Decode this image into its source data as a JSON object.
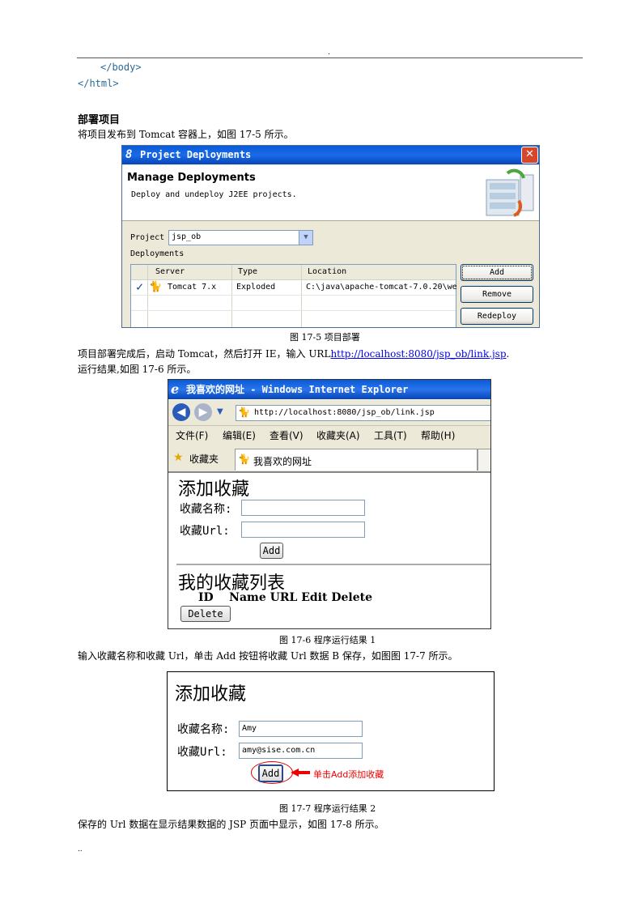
{
  "header_mark": ".",
  "code_lines": [
    "</body>",
    "</html>"
  ],
  "section_heading": "部署项目",
  "para1": "将项目发布到 Tomcat 容器上，如图 17-5 所示。",
  "fig_deploy": {
    "title": "Project Deployments",
    "title_icon": "eclipse-8-icon",
    "close": "✕",
    "heading": "Manage Deployments",
    "subheading": "Deploy and undeploy J2EE projects.",
    "project_label": "Project",
    "project_value": "jsp_ob",
    "deployments_label": "Deployments",
    "columns": [
      "Server",
      "Type",
      "Location"
    ],
    "row": {
      "server": "Tomcat  7.x",
      "type": "Exploded",
      "location": "C:\\java\\apache-tomcat-7.0.20\\we"
    },
    "buttons": {
      "add": "Add",
      "remove": "Remove",
      "redeploy": "Redeploy"
    }
  },
  "caption1": "图 17-5    项目部署",
  "para2_prefix": "项目部署完成后，启动 Tomcat，然后打开 IE，输入 URL",
  "para2_link": "http://localhost:8080/jsp_ob/link.jsp",
  "para2_suffix": ".",
  "para3": "运行结果,如图 17-6 所示。",
  "fig_ie": {
    "title": "我喜欢的网址 - Windows Internet Explorer",
    "url": "http://localhost:8080/jsp_ob/link.jsp",
    "menu": [
      "文件(F)",
      "编辑(E)",
      "查看(V)",
      "收藏夹(A)",
      "工具(T)",
      "帮助(H)"
    ],
    "favorites": "收藏夹",
    "tab_title": "我喜欢的网址",
    "page_heading": "添加收藏",
    "name_label": "收藏名称:",
    "url_label": "收藏Url:",
    "add_button": "Add",
    "list_heading": "我的收藏列表",
    "list_columns": "ID    Name URL Edit Delete",
    "delete_button": "Delete"
  },
  "caption2": "图 17-6  程序运行结果 1",
  "para4": "输入收藏名称和收藏 Url，单击 Add 按钮将收藏 Url 数据 B 保存，如图图 17-7 所示。",
  "fig_form": {
    "heading": "添加收藏",
    "name_label": "收藏名称:",
    "name_value": "Amy",
    "url_label": "收藏Url:",
    "url_value": "amy@sise.com.cn",
    "add_button": "Add",
    "annotation": "单击Add添加收藏",
    "annotation_color": "#e00000"
  },
  "caption3": "图 17-7  程序运行结果 2",
  "para5": "保存的 Url 数据在显示结果数据的 JSP 页面中显示，如图 17-8 所示。",
  "footer_mark": ".."
}
